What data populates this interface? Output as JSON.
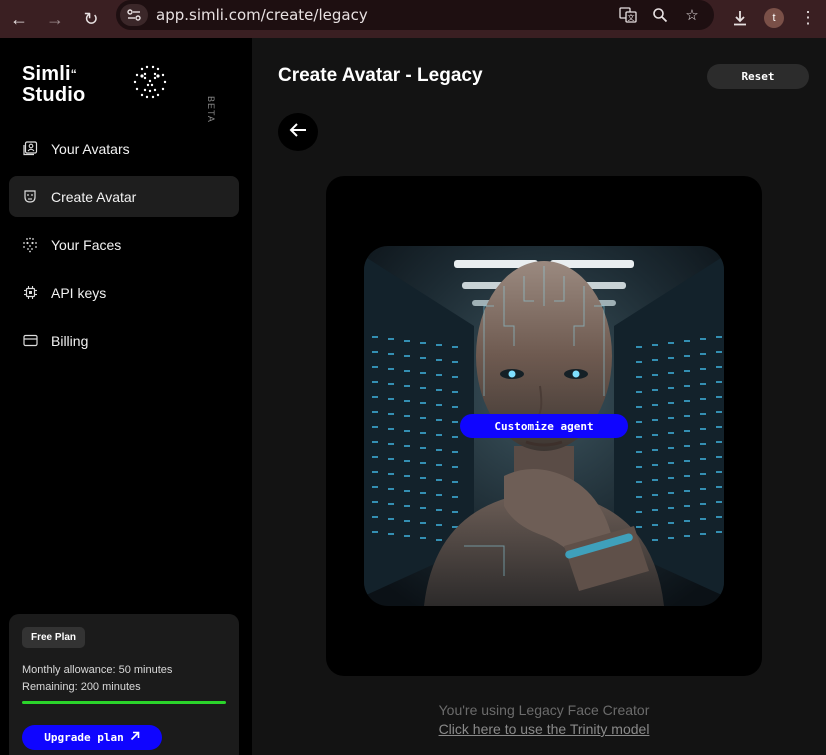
{
  "browser": {
    "url": "app.simli.com/create/legacy",
    "profile_initial": "t"
  },
  "sidebar": {
    "brand_line1": "Simli",
    "brand_line2": "Studio",
    "beta": "BETA",
    "items": [
      {
        "label": "Your Avatars",
        "icon": "user-square-icon",
        "active": false
      },
      {
        "label": "Create Avatar",
        "icon": "create-avatar-icon",
        "active": true
      },
      {
        "label": "Your Faces",
        "icon": "face-icon",
        "active": false
      },
      {
        "label": "API keys",
        "icon": "chip-icon",
        "active": false
      },
      {
        "label": "Billing",
        "icon": "card-icon",
        "active": false
      }
    ],
    "plan": {
      "badge": "Free Plan",
      "allowance": "Monthly allowance: 50 minutes",
      "remaining": "Remaining: 200 minutes",
      "progress_fraction": 1.0,
      "upgrade_label": "Upgrade plan"
    }
  },
  "main": {
    "title": "Create Avatar - Legacy",
    "reset_label": "Reset",
    "customize_label": "Customize agent",
    "legacy_note": "You're using Legacy Face Creator",
    "trinity_link": "Click here to use the Trinity model"
  },
  "colors": {
    "accent_blue": "#0f05ff",
    "progress_green": "#2bd42b",
    "chrome_bg": "#3a1f22"
  }
}
